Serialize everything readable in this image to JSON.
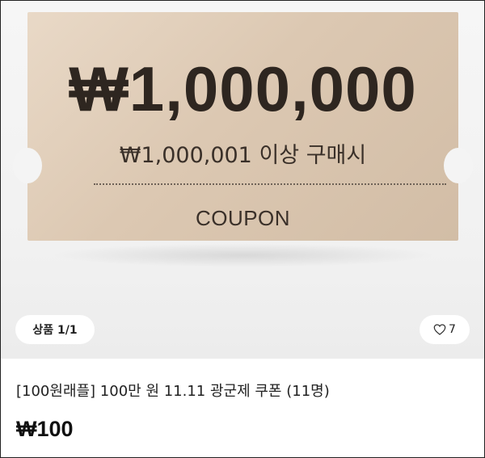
{
  "coupon": {
    "amount": "₩1,000,000",
    "condition": "₩1,000,001 이상 구매시",
    "label": "COUPON"
  },
  "image_counter": "상품 1/1",
  "likes": "7",
  "product": {
    "title": "[100원래플] 100만 원 11.11 광군제 쿠폰 (11명)",
    "price": "₩100"
  }
}
